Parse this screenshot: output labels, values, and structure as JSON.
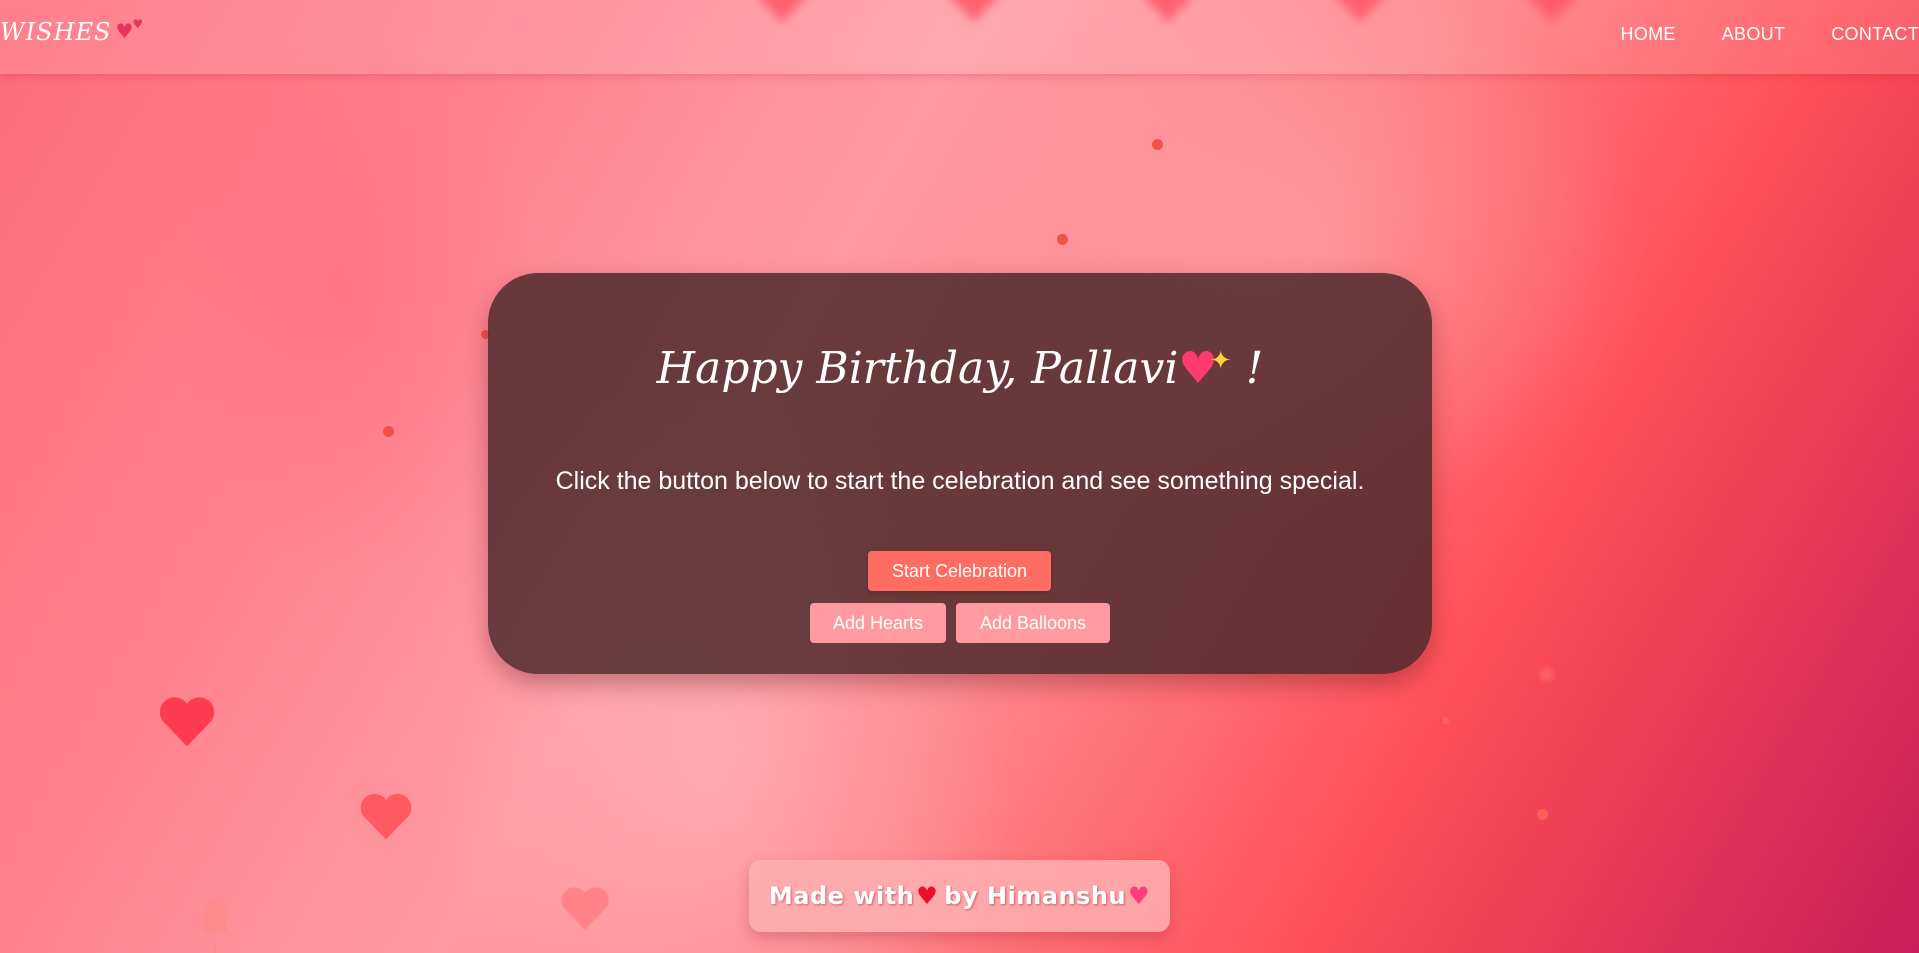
{
  "header": {
    "logo_text": "WISHES",
    "logo_icon": "two-hearts-icon",
    "nav": [
      {
        "label": "HOME"
      },
      {
        "label": "ABOUT"
      },
      {
        "label": "CONTACT"
      }
    ]
  },
  "card": {
    "title_text": "Happy Birthday, Pallavi",
    "title_emoji_icon": "sparkling-heart-icon",
    "title_end": "!",
    "subtitle": "Click the button below to start the celebration and see something special.",
    "buttons": {
      "start_label": "Start Celebration",
      "hearts_label": "Add Hearts",
      "balloons_label": "Add Balloons"
    }
  },
  "footer": {
    "made_with": "Made with",
    "red_heart_icon": "red-heart-icon",
    "by_text": "by Himanshu",
    "end_icon": "two-hearts-icon"
  },
  "colors": {
    "primary_button": "#ff6d62",
    "secondary_button": "#ff9aa0",
    "card_background": "#4b282a",
    "heart_red": "#ff3b4f"
  }
}
